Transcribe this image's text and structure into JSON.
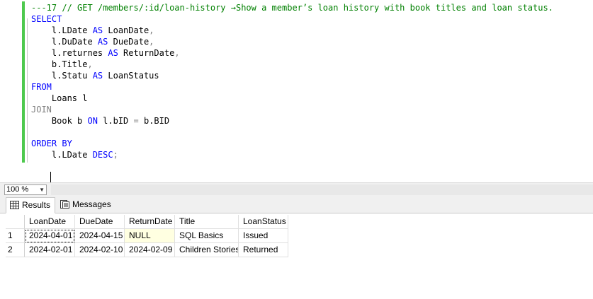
{
  "editor": {
    "lines": [
      {
        "segments": [
          {
            "text": "---17 // GET /members/:id/loan-history →Show a member’s loan history with book titles and loan status.",
            "style": "cmt"
          }
        ]
      },
      {
        "segments": [
          {
            "text": "SELECT",
            "style": "kw"
          }
        ]
      },
      {
        "segments": [
          {
            "text": "    l.LDate ",
            "style": "plain"
          },
          {
            "text": "AS",
            "style": "kw"
          },
          {
            "text": " LoanDate",
            "style": "plain"
          },
          {
            "text": ",",
            "style": "gray"
          }
        ]
      },
      {
        "segments": [
          {
            "text": "    l.DuDate ",
            "style": "plain"
          },
          {
            "text": "AS",
            "style": "kw"
          },
          {
            "text": " DueDate",
            "style": "plain"
          },
          {
            "text": ",",
            "style": "gray"
          }
        ]
      },
      {
        "segments": [
          {
            "text": "    l.returnes ",
            "style": "plain"
          },
          {
            "text": "AS",
            "style": "kw"
          },
          {
            "text": " ReturnDate",
            "style": "plain"
          },
          {
            "text": ",",
            "style": "gray"
          }
        ]
      },
      {
        "segments": [
          {
            "text": "    b.Title",
            "style": "plain"
          },
          {
            "text": ",",
            "style": "gray"
          }
        ]
      },
      {
        "segments": [
          {
            "text": "    l.Statu ",
            "style": "plain"
          },
          {
            "text": "AS",
            "style": "kw"
          },
          {
            "text": " LoanStatus",
            "style": "plain"
          }
        ]
      },
      {
        "segments": [
          {
            "text": "FROM",
            "style": "kw"
          }
        ]
      },
      {
        "segments": [
          {
            "text": "    Loans l",
            "style": "plain"
          }
        ]
      },
      {
        "segments": [
          {
            "text": "JOIN",
            "style": "gray"
          }
        ]
      },
      {
        "segments": [
          {
            "text": "    Book b ",
            "style": "plain"
          },
          {
            "text": "ON",
            "style": "kw"
          },
          {
            "text": " l.bID ",
            "style": "plain"
          },
          {
            "text": "=",
            "style": "gray"
          },
          {
            "text": " b.BID",
            "style": "plain"
          }
        ]
      },
      {
        "segments": []
      },
      {
        "segments": [
          {
            "text": "ORDER BY",
            "style": "kw"
          }
        ]
      },
      {
        "segments": [
          {
            "text": "    l.LDate ",
            "style": "plain"
          },
          {
            "text": "DESC",
            "style": "kw"
          },
          {
            "text": ";",
            "style": "gray"
          }
        ]
      }
    ]
  },
  "zoom": {
    "value": "100 %"
  },
  "tabs": {
    "results_label": "Results",
    "messages_label": "Messages"
  },
  "grid": {
    "columns": [
      "LoanDate",
      "DueDate",
      "ReturnDate",
      "Title",
      "LoanStatus"
    ],
    "rows": [
      {
        "num": "1",
        "cells": [
          "2024-04-01",
          "2024-04-15",
          "NULL",
          "SQL Basics",
          "Issued"
        ]
      },
      {
        "num": "2",
        "cells": [
          "2024-02-01",
          "2024-02-10",
          "2024-02-09",
          "Children Stories",
          "Returned"
        ]
      }
    ]
  },
  "colors": {
    "keyword": "#0000ff",
    "comment": "#008000",
    "operator": "#808080",
    "change_bar": "#4ec94e",
    "null_cell": "#ffffe1"
  }
}
